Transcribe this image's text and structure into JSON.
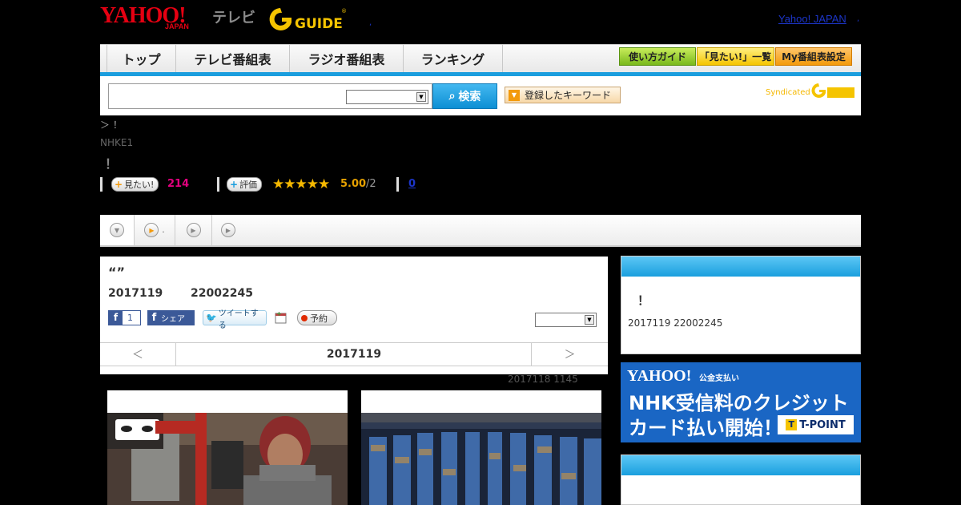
{
  "header": {
    "logo_yahoo": "YAHOO!",
    "logo_japan": "JAPAN",
    "logo_tv": "テレビ",
    "logo_gguide": "GUIDE",
    "dot": ",",
    "yahoo_japan_link": "Yahoo! JAPAN",
    "yahoo_japan_dot": ","
  },
  "nav": {
    "tabs": [
      "トップ",
      "テレビ番組表",
      "ラジオ番組表",
      "ランキング"
    ],
    "buttons": [
      "使い方ガイド",
      "「見たい!」一覧",
      "My番組表設定"
    ]
  },
  "search": {
    "input_value": "",
    "select_value": "",
    "button_label": "検索",
    "keyword_button": "登録したキーワード",
    "syndicated": "Syndicated"
  },
  "program": {
    "breadcrumb": "＞ ！",
    "channel": "NHKE1",
    "title_excl": "！",
    "want_label": "見たい!",
    "want_count": "214",
    "rate_label": "評価",
    "stars": "★★★★★",
    "score": "5.00",
    "score_den": "/2",
    "reviews": "0"
  },
  "tabs": {
    "tab2_dot": "."
  },
  "detail": {
    "quote": "“”",
    "date": "2017119",
    "time": "22002245",
    "fb_count": "1",
    "fb_share": "シェア",
    "tweet": "ツイートする",
    "reserve": "予約",
    "select_value": "",
    "day_prev": "＜",
    "day_current": "2017119",
    "day_next": "＞",
    "updated": "2017118  1145"
  },
  "sidebar": {
    "excl": "！",
    "date_time": "2017119  22002245",
    "banner": {
      "yahoo": "YAHOO!",
      "service": "公金支払い",
      "line1": "NHK受信料のクレジット",
      "line2": "カード払い開始！",
      "tpoint": "T-POINT",
      "tpoint_t": "T"
    }
  },
  "colors": {
    "accent_blue": "#1b9ede",
    "yahoo_red": "#e60012",
    "want_pink": "#e4007f",
    "star_gold": "#f5b800",
    "banner_blue": "#1a66c4"
  }
}
